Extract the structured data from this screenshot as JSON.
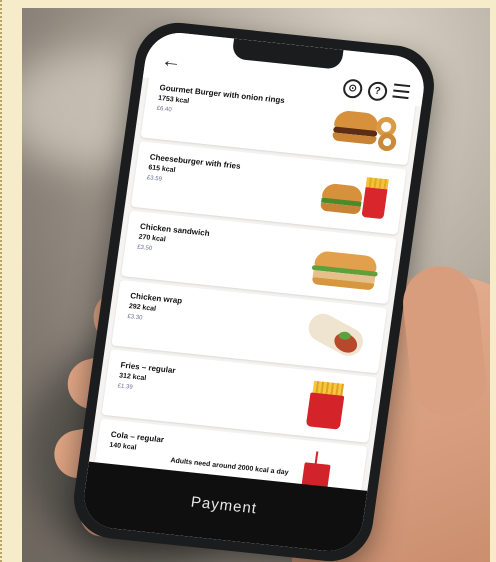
{
  "header": {
    "back_icon": "back-arrow-icon",
    "icons": [
      "location-pin-icon",
      "help-icon",
      "menu-icon"
    ]
  },
  "menu_items": [
    {
      "name": "Gourmet Burger with onion rings",
      "kcal": "1753 kcal",
      "price": "£6.40",
      "icon": "burger-onion-rings-image"
    },
    {
      "name": "Cheeseburger with fries",
      "kcal": "615 kcal",
      "price": "£3.59",
      "icon": "cheeseburger-fries-image"
    },
    {
      "name": "Chicken sandwich",
      "kcal": "270 kcal",
      "price": "£3.50",
      "icon": "chicken-sandwich-image"
    },
    {
      "name": "Chicken wrap",
      "kcal": "292 kcal",
      "price": "£3.30",
      "icon": "chicken-wrap-image"
    },
    {
      "name": "Fries – regular",
      "kcal": "312 kcal",
      "price": "£1.39",
      "icon": "fries-image"
    },
    {
      "name": "Cola – regular",
      "kcal": "140 kcal",
      "price": "",
      "icon": "cola-cup-image"
    }
  ],
  "note": "Adults need around 2000 kcal a day",
  "payment_label": "Payment"
}
